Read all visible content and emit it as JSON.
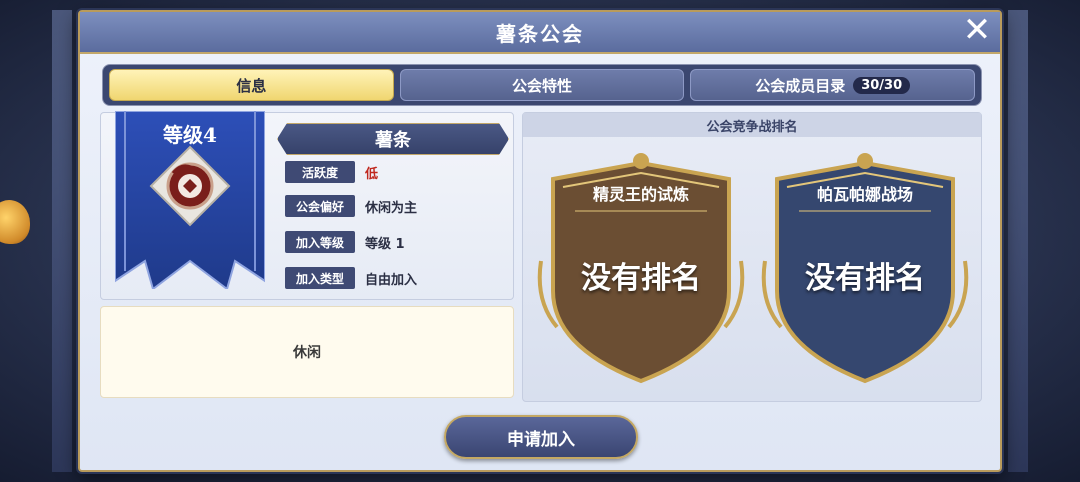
{
  "dialog": {
    "title": "薯条公会",
    "close_icon": "close-icon"
  },
  "tabs": [
    {
      "label": "信息",
      "active": true
    },
    {
      "label": "公会特性",
      "active": false
    },
    {
      "label": "公会成员目录",
      "active": false,
      "badge": "30/30"
    }
  ],
  "info": {
    "level": "等级4",
    "guild_name": "薯条",
    "rows": [
      {
        "label": "活跃度",
        "value": "低"
      },
      {
        "label": "公会偏好",
        "value": "休闲为主"
      },
      {
        "label": "加入等级",
        "value": "等级 1"
      },
      {
        "label": "加入类型",
        "value": "自由加入"
      }
    ],
    "description": "休闲"
  },
  "ranking": {
    "header": "公会竞争战排名",
    "shields": [
      {
        "title": "精灵王的试炼",
        "rank": "没有排名",
        "color": "#6b4e33"
      },
      {
        "title": "帕瓦帕娜战场",
        "rank": "没有排名",
        "color": "#35476f"
      }
    ]
  },
  "actions": {
    "join_label": "申请加入"
  },
  "colors": {
    "accent_gold": "#c2a769",
    "active_tab": "#f0d670",
    "activity_low": "#c0281e"
  }
}
